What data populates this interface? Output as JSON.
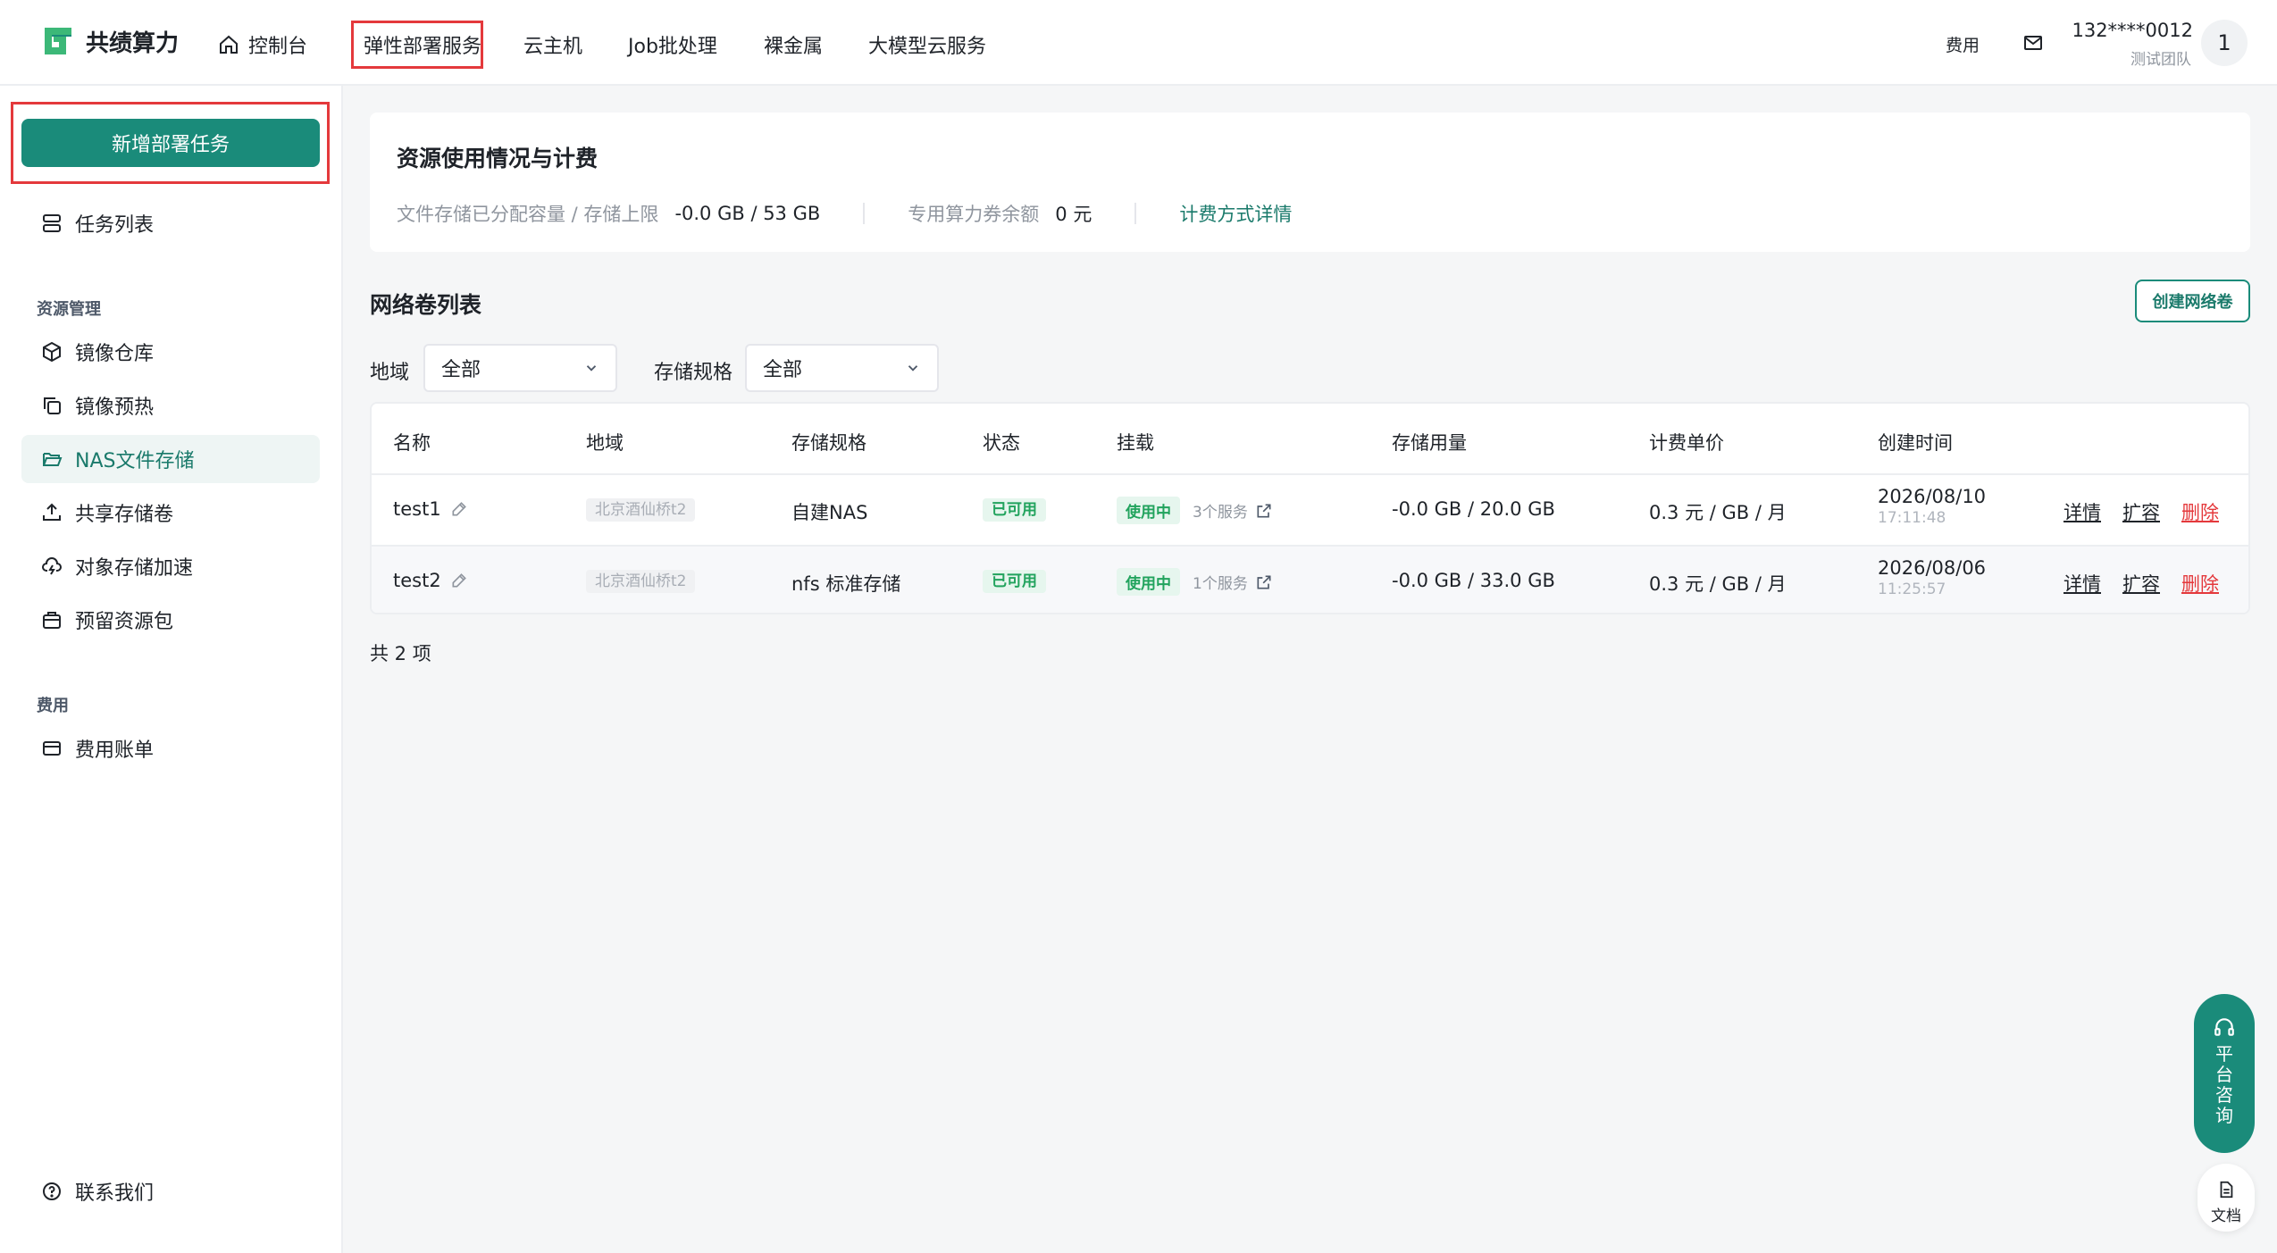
{
  "brand": {
    "name": "共绩算力",
    "color": "#1a8b7a"
  },
  "topnav": {
    "home": "控制台",
    "items": [
      "弹性部署服务",
      "云主机",
      "Job批处理",
      "裸金属",
      "大模型云服务"
    ]
  },
  "header_right": {
    "fee": "费用",
    "user_phone": "132****0012",
    "user_team": "测试团队",
    "avatar_text": "1"
  },
  "sidebar": {
    "new_task": "新增部署任务",
    "task_list": "任务列表",
    "section_resource": "资源管理",
    "resource_items": [
      "镜像仓库",
      "镜像预热",
      "NAS文件存储",
      "共享存储卷",
      "对象存储加速",
      "预留资源包"
    ],
    "section_fee": "费用",
    "fee_items": [
      "费用账单"
    ],
    "contact": "联系我们"
  },
  "usage": {
    "title": "资源使用情况与计费",
    "storage_label": "文件存储已分配容量 / 存储上限",
    "storage_value": "-0.0 GB / 53 GB",
    "voucher_label": "专用算力券余额",
    "voucher_value": "0 元",
    "billing_link": "计费方式详情"
  },
  "volumes": {
    "title": "网络卷列表",
    "create_button": "创建网络卷",
    "filters": {
      "region_label": "地域",
      "region_value": "全部",
      "spec_label": "存储规格",
      "spec_value": "全部"
    },
    "columns": [
      "名称",
      "地域",
      "存储规格",
      "状态",
      "挂载",
      "存储用量",
      "计费单价",
      "创建时间"
    ],
    "rows": [
      {
        "name": "test1",
        "region": "北京酒仙桥t2",
        "spec": "自建NAS",
        "status": "已可用",
        "mount_status": "使用中",
        "mount_services": "3个服务",
        "usage": "-0.0 GB / 20.0 GB",
        "price": "0.3 元 / GB / 月",
        "date": "2026/08/10",
        "time": "17:11:48"
      },
      {
        "name": "test2",
        "region": "北京酒仙桥t2",
        "spec": "nfs 标准存储",
        "status": "已可用",
        "mount_status": "使用中",
        "mount_services": "1个服务",
        "usage": "-0.0 GB / 33.0 GB",
        "price": "0.3 元 / GB / 月",
        "date": "2026/08/06",
        "time": "11:25:57"
      }
    ],
    "actions": {
      "detail": "详情",
      "expand": "扩容",
      "delete": "删除"
    },
    "total": "共 2 项"
  },
  "floating": {
    "consult": "平台咨询",
    "docs": "文档"
  }
}
